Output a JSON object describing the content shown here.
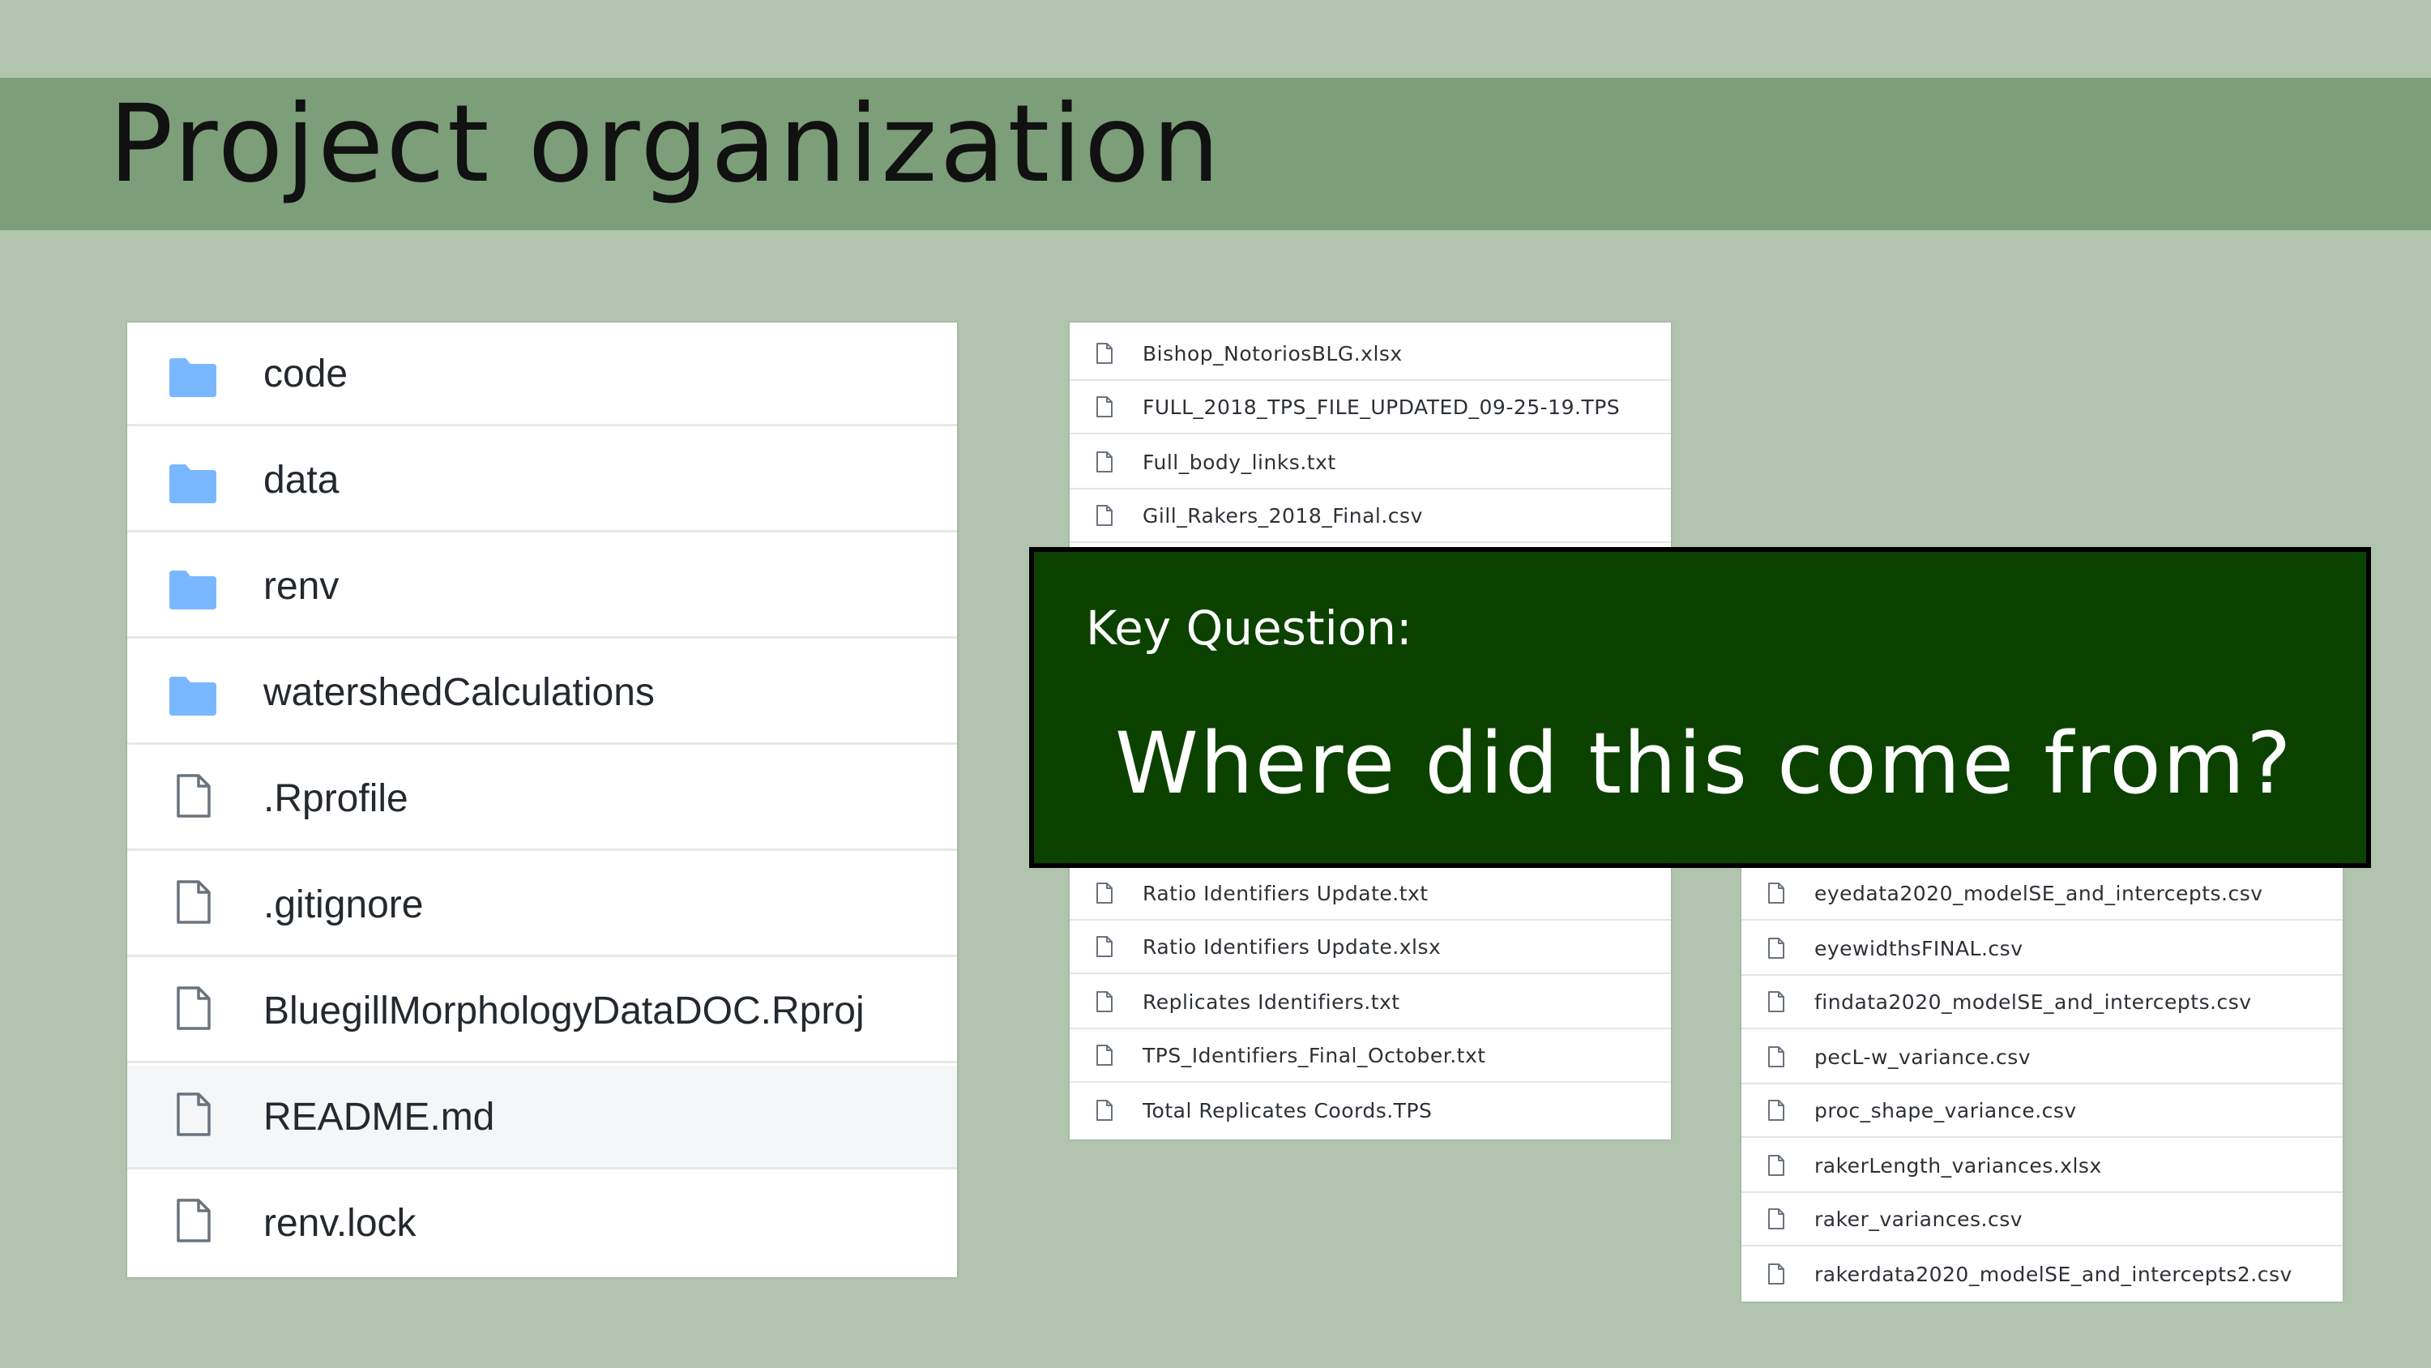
{
  "slide": {
    "title": "Project organization"
  },
  "repo_listing": {
    "items": [
      {
        "name": "code",
        "icon": "folder-icon"
      },
      {
        "name": "data",
        "icon": "folder-icon"
      },
      {
        "name": "renv",
        "icon": "folder-icon"
      },
      {
        "name": "watershedCalculations",
        "icon": "folder-icon"
      },
      {
        "name": ".Rprofile",
        "icon": "file-icon"
      },
      {
        "name": ".gitignore",
        "icon": "file-icon"
      },
      {
        "name": "BluegillMorphologyDataDOC.Rproj",
        "icon": "file-icon"
      },
      {
        "name": "README.md",
        "icon": "file-icon"
      },
      {
        "name": "renv.lock",
        "icon": "file-icon"
      }
    ]
  },
  "data_listing_top": {
    "items": [
      "Bishop_NotoriosBLG.xlsx",
      "FULL_2018_TPS_FILE_UPDATED_09-25-19.TPS",
      "Full_body_links.txt",
      "Gill_Rakers_2018_Final.csv"
    ]
  },
  "data_listing_bottom": {
    "items": [
      "Ratio Identifiers Update.txt",
      "Ratio Identifiers Update.xlsx",
      "Replicates Identifiers.txt",
      "TPS_Identifiers_Final_October.txt",
      "Total Replicates Coords.TPS"
    ]
  },
  "results_listing": {
    "items": [
      "eyedata2020_modelSE_and_intercepts.csv",
      "eyewidthsFINAL.csv",
      "findata2020_modelSE_and_intercepts.csv",
      "pecL-w_variance.csv",
      "proc_shape_variance.csv",
      "rakerLength_variances.xlsx",
      "raker_variances.csv",
      "rakerdata2020_modelSE_and_intercepts2.csv"
    ]
  },
  "callout": {
    "label": "Key Question:",
    "question": "Where did this come from?"
  },
  "colors": {
    "background": "#b0c4ae",
    "title_bar": "#7c9e79",
    "callout_bg": "#0c4200",
    "folder": "#79b8ff"
  }
}
